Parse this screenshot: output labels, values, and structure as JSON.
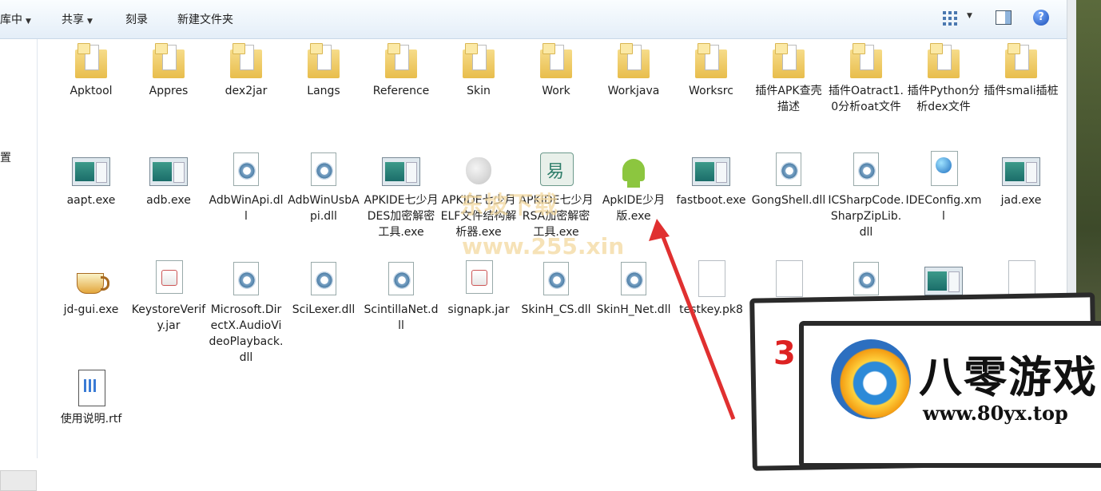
{
  "toolbar": {
    "library_label": "库中",
    "share_label": "共享",
    "burn_label": "刻录",
    "new_folder_label": "新建文件夹",
    "help_glyph": "?"
  },
  "navpane": {
    "partial_label": "置"
  },
  "files": [
    {
      "name": "Apktool",
      "icon": "folder-icon"
    },
    {
      "name": "Appres",
      "icon": "folder-icon"
    },
    {
      "name": "dex2jar",
      "icon": "folder-icon"
    },
    {
      "name": "Langs",
      "icon": "folder-icon"
    },
    {
      "name": "Reference",
      "icon": "folder-icon"
    },
    {
      "name": "Skin",
      "icon": "folder-icon"
    },
    {
      "name": "Work",
      "icon": "folder-icon"
    },
    {
      "name": "Workjava",
      "icon": "folder-icon"
    },
    {
      "name": "Worksrc",
      "icon": "folder-icon"
    },
    {
      "name": "插件APK查壳描述",
      "icon": "folder-icon"
    },
    {
      "name": "插件Oatract1.0分析oat文件",
      "icon": "folder-icon"
    },
    {
      "name": "插件Python分析dex文件",
      "icon": "folder-icon"
    },
    {
      "name": "插件smali插桩",
      "icon": "folder-icon"
    },
    {
      "name": "aapt.exe",
      "icon": "exe-window-icon"
    },
    {
      "name": "adb.exe",
      "icon": "exe-window-icon"
    },
    {
      "name": "AdbWinApi.dll",
      "icon": "dll-gear-icon"
    },
    {
      "name": "AdbWinUsbApi.dll",
      "icon": "dll-gear-icon"
    },
    {
      "name": "APKIDE七少月DES加密解密工具.exe",
      "icon": "exe-window-icon"
    },
    {
      "name": "APKIDE七少月ELF文件结构解析器.exe",
      "icon": "apple-icon"
    },
    {
      "name": "APKIDE七少月RSA加密解密工具.exe",
      "icon": "rsa-tool-icon"
    },
    {
      "name": "ApkIDE少月版.exe",
      "icon": "android-icon"
    },
    {
      "name": "fastboot.exe",
      "icon": "exe-window-icon"
    },
    {
      "name": "GongShell.dll",
      "icon": "dll-gear-icon"
    },
    {
      "name": "ICSharpCode.SharpZipLib.dll",
      "icon": "dll-gear-icon"
    },
    {
      "name": "IDEConfig.xml",
      "icon": "xml-globe-icon"
    },
    {
      "name": "jad.exe",
      "icon": "exe-window-icon"
    },
    {
      "name": "jd-gui.exe",
      "icon": "coffee-cup-icon"
    },
    {
      "name": "KeystoreVerify.jar",
      "icon": "java-jar-icon"
    },
    {
      "name": "Microsoft.DirectX.AudioVideoPlayback.dll",
      "icon": "dll-gear-icon"
    },
    {
      "name": "SciLexer.dll",
      "icon": "dll-gear-icon"
    },
    {
      "name": "ScintillaNet.dll",
      "icon": "dll-gear-icon"
    },
    {
      "name": "signapk.jar",
      "icon": "java-jar-icon"
    },
    {
      "name": "SkinH_CS.dll",
      "icon": "dll-gear-icon"
    },
    {
      "name": "SkinH_Net.dll",
      "icon": "dll-gear-icon"
    },
    {
      "name": "testkey.pk8",
      "icon": "blank-document-icon"
    },
    {
      "name": "",
      "icon": "blank-document-icon"
    },
    {
      "name": "",
      "icon": "dll-gear-icon"
    },
    {
      "name": "",
      "icon": "exe-window-icon"
    },
    {
      "name": "",
      "icon": "blank-document-icon"
    },
    {
      "name": "使用说明.rtf",
      "icon": "rtf-document-icon"
    }
  ],
  "watermarks": {
    "site_cn": "东坡下载",
    "site_url": "www.255.xin"
  },
  "logo": {
    "number": "3",
    "brand": "八零游戏",
    "url": "www.80yx.top"
  },
  "colors": {
    "toolbar_top": "#fafdff",
    "toolbar_bottom": "#e4eef8",
    "arrow": "#e03030"
  }
}
